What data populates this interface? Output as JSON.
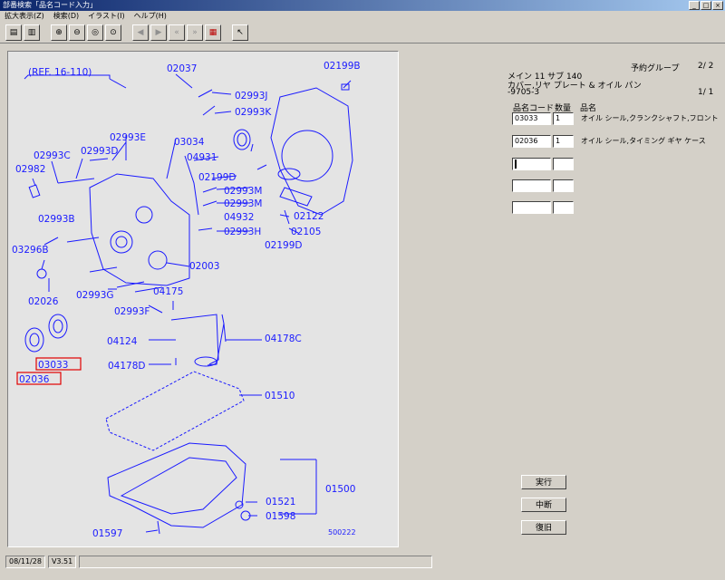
{
  "window": {
    "title": "部番検索「品名コード入力」",
    "min": "_",
    "max": "□",
    "close": "×"
  },
  "menu": [
    "拡大表示(Z)",
    "検索(D)",
    "イラスト(I)",
    "ヘルプ(H)"
  ],
  "diagram": {
    "ref": "(REF. 16-110)",
    "code": "500222",
    "labels": {
      "p02037": "02037",
      "p02199B": "02199B",
      "p02993J": "02993J",
      "p02993K": "02993K",
      "p02993E": "02993E",
      "p03034": "03034",
      "p02993C": "02993C",
      "p02993D": "02993D",
      "p04931": "04931",
      "p02982": "02982",
      "p02199D_a": "02199D",
      "p02993M_a": "02993M",
      "p02993M_b": "02993M",
      "p02122": "02122",
      "p04932": "04932",
      "p02993B": "02993B",
      "p02105": "02105",
      "p02993H": "02993H",
      "p02199D_b": "02199D",
      "p03296B": "03296B",
      "p02003": "02003",
      "p02026": "02026",
      "p02993G": "02993G",
      "p04175": "04175",
      "p02993F": "02993F",
      "p04124": "04124",
      "p04178C": "04178C",
      "p03033": "03033",
      "p04178D": "04178D",
      "p02036": "02036",
      "p01510": "01510",
      "p01500": "01500",
      "p01521": "01521",
      "p01598": "01598",
      "p01597": "01597"
    }
  },
  "right": {
    "group_label": "予約グループ",
    "group_page": "2/ 2",
    "main_sub": "メイン 11  サブ 140",
    "desc": "カバー,リヤ プレート & オイル パン",
    "model": "-9705-3",
    "page": "1/ 1",
    "col_code": "品名コード",
    "col_qty": "数量",
    "col_name": "品名",
    "rows": [
      {
        "code": "03033",
        "qty": "1",
        "name": "オイル シール,クランクシャフト,フロント"
      },
      {
        "code": "02036",
        "qty": "1",
        "name": "オイル シール,タイミング ギヤ ケース"
      },
      {
        "code": "",
        "qty": "",
        "name": ""
      },
      {
        "code": "",
        "qty": "",
        "name": ""
      },
      {
        "code": "",
        "qty": "",
        "name": ""
      }
    ],
    "btn_run": "実行",
    "btn_stop": "中断",
    "btn_return": "復旧"
  },
  "status": {
    "date": "08/11/28",
    "version": "V3.51",
    "message": ""
  }
}
